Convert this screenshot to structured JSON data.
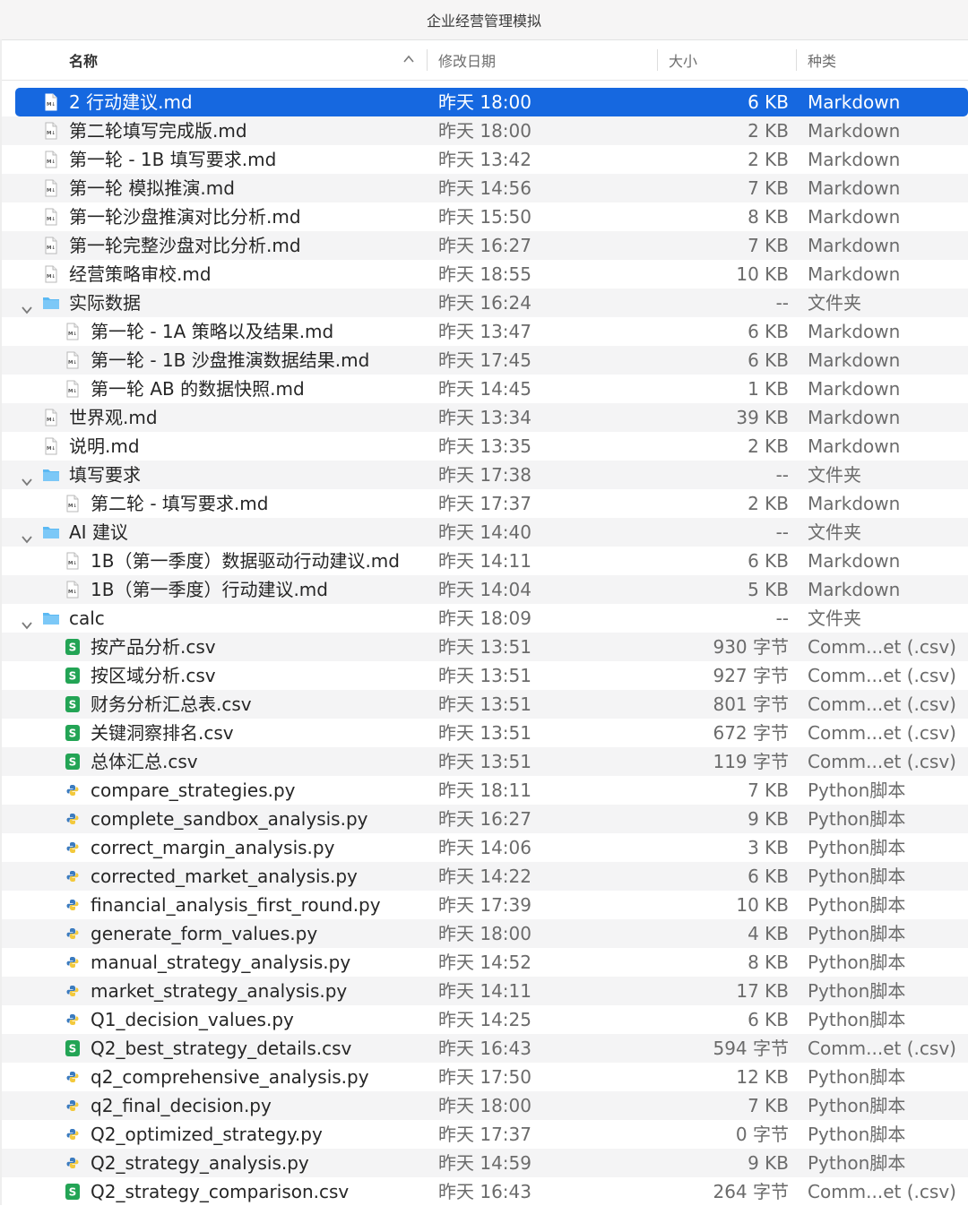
{
  "window": {
    "title": "企业经营管理模拟"
  },
  "columns": {
    "name": "名称",
    "date": "修改日期",
    "size": "大小",
    "kind": "种类"
  },
  "rows": [
    {
      "name": "2 行动建议.md",
      "date": "昨天 18:00",
      "size": "6 KB",
      "kind": "Markdown",
      "icon": "md",
      "level": 0,
      "selected": true
    },
    {
      "name": "第二轮填写完成版.md",
      "date": "昨天 18:00",
      "size": "2 KB",
      "kind": "Markdown",
      "icon": "md",
      "level": 0
    },
    {
      "name": "第一轮 - 1B 填写要求.md",
      "date": "昨天 13:42",
      "size": "2 KB",
      "kind": "Markdown",
      "icon": "md",
      "level": 0
    },
    {
      "name": "第一轮 模拟推演.md",
      "date": "昨天 14:56",
      "size": "7 KB",
      "kind": "Markdown",
      "icon": "md",
      "level": 0
    },
    {
      "name": "第一轮沙盘推演对比分析.md",
      "date": "昨天 15:50",
      "size": "8 KB",
      "kind": "Markdown",
      "icon": "md",
      "level": 0
    },
    {
      "name": "第一轮完整沙盘对比分析.md",
      "date": "昨天 16:27",
      "size": "7 KB",
      "kind": "Markdown",
      "icon": "md",
      "level": 0
    },
    {
      "name": "经营策略审校.md",
      "date": "昨天 18:55",
      "size": "10 KB",
      "kind": "Markdown",
      "icon": "md",
      "level": 0
    },
    {
      "name": "实际数据",
      "date": "昨天 16:24",
      "size": "--",
      "kind": "文件夹",
      "icon": "folder",
      "level": 0
    },
    {
      "name": "第一轮 - 1A 策略以及结果.md",
      "date": "昨天 13:47",
      "size": "6 KB",
      "kind": "Markdown",
      "icon": "md",
      "level": 1
    },
    {
      "name": "第一轮 - 1B 沙盘推演数据结果.md",
      "date": "昨天 17:45",
      "size": "6 KB",
      "kind": "Markdown",
      "icon": "md",
      "level": 1
    },
    {
      "name": "第一轮 AB 的数据快照.md",
      "date": "昨天 14:45",
      "size": "1 KB",
      "kind": "Markdown",
      "icon": "md",
      "level": 1
    },
    {
      "name": "世界观.md",
      "date": "昨天 13:34",
      "size": "39 KB",
      "kind": "Markdown",
      "icon": "md",
      "level": 0
    },
    {
      "name": "说明.md",
      "date": "昨天 13:35",
      "size": "2 KB",
      "kind": "Markdown",
      "icon": "md",
      "level": 0
    },
    {
      "name": "填写要求",
      "date": "昨天 17:38",
      "size": "--",
      "kind": "文件夹",
      "icon": "folder",
      "level": 0
    },
    {
      "name": "第二轮 - 填写要求.md",
      "date": "昨天 17:37",
      "size": "2 KB",
      "kind": "Markdown",
      "icon": "md",
      "level": 1
    },
    {
      "name": "AI 建议",
      "date": "昨天 14:40",
      "size": "--",
      "kind": "文件夹",
      "icon": "folder",
      "level": 0
    },
    {
      "name": "1B（第一季度）数据驱动行动建议.md",
      "date": "昨天 14:11",
      "size": "6 KB",
      "kind": "Markdown",
      "icon": "md",
      "level": 1
    },
    {
      "name": "1B（第一季度）行动建议.md",
      "date": "昨天 14:04",
      "size": "5 KB",
      "kind": "Markdown",
      "icon": "md",
      "level": 1
    },
    {
      "name": "calc",
      "date": "昨天 18:09",
      "size": "--",
      "kind": "文件夹",
      "icon": "folder",
      "level": 0
    },
    {
      "name": "按产品分析.csv",
      "date": "昨天 13:51",
      "size": "930 字节",
      "kind": "Comm...et (.csv)",
      "icon": "csv",
      "level": 1
    },
    {
      "name": "按区域分析.csv",
      "date": "昨天 13:51",
      "size": "927 字节",
      "kind": "Comm...et (.csv)",
      "icon": "csv",
      "level": 1
    },
    {
      "name": "财务分析汇总表.csv",
      "date": "昨天 13:51",
      "size": "801 字节",
      "kind": "Comm...et (.csv)",
      "icon": "csv",
      "level": 1
    },
    {
      "name": "关键洞察排名.csv",
      "date": "昨天 13:51",
      "size": "672 字节",
      "kind": "Comm...et (.csv)",
      "icon": "csv",
      "level": 1
    },
    {
      "name": "总体汇总.csv",
      "date": "昨天 13:51",
      "size": "119 字节",
      "kind": "Comm...et (.csv)",
      "icon": "csv",
      "level": 1
    },
    {
      "name": "compare_strategies.py",
      "date": "昨天 18:11",
      "size": "7 KB",
      "kind": "Python脚本",
      "icon": "py",
      "level": 1
    },
    {
      "name": "complete_sandbox_analysis.py",
      "date": "昨天 16:27",
      "size": "9 KB",
      "kind": "Python脚本",
      "icon": "py",
      "level": 1
    },
    {
      "name": "correct_margin_analysis.py",
      "date": "昨天 14:06",
      "size": "3 KB",
      "kind": "Python脚本",
      "icon": "py",
      "level": 1
    },
    {
      "name": "corrected_market_analysis.py",
      "date": "昨天 14:22",
      "size": "6 KB",
      "kind": "Python脚本",
      "icon": "py",
      "level": 1
    },
    {
      "name": "financial_analysis_first_round.py",
      "date": "昨天 17:39",
      "size": "10 KB",
      "kind": "Python脚本",
      "icon": "py",
      "level": 1
    },
    {
      "name": "generate_form_values.py",
      "date": "昨天 18:00",
      "size": "4 KB",
      "kind": "Python脚本",
      "icon": "py",
      "level": 1
    },
    {
      "name": "manual_strategy_analysis.py",
      "date": "昨天 14:52",
      "size": "8 KB",
      "kind": "Python脚本",
      "icon": "py",
      "level": 1
    },
    {
      "name": "market_strategy_analysis.py",
      "date": "昨天 14:11",
      "size": "17 KB",
      "kind": "Python脚本",
      "icon": "py",
      "level": 1
    },
    {
      "name": "Q1_decision_values.py",
      "date": "昨天 14:25",
      "size": "6 KB",
      "kind": "Python脚本",
      "icon": "py",
      "level": 1
    },
    {
      "name": "Q2_best_strategy_details.csv",
      "date": "昨天 16:43",
      "size": "594 字节",
      "kind": "Comm...et (.csv)",
      "icon": "csv",
      "level": 1
    },
    {
      "name": "q2_comprehensive_analysis.py",
      "date": "昨天 17:50",
      "size": "12 KB",
      "kind": "Python脚本",
      "icon": "py",
      "level": 1
    },
    {
      "name": "q2_final_decision.py",
      "date": "昨天 18:00",
      "size": "7 KB",
      "kind": "Python脚本",
      "icon": "py",
      "level": 1
    },
    {
      "name": "Q2_optimized_strategy.py",
      "date": "昨天 17:37",
      "size": "0 字节",
      "kind": "Python脚本",
      "icon": "py",
      "level": 1
    },
    {
      "name": "Q2_strategy_analysis.py",
      "date": "昨天 14:59",
      "size": "9 KB",
      "kind": "Python脚本",
      "icon": "py",
      "level": 1
    },
    {
      "name": "Q2_strategy_comparison.csv",
      "date": "昨天 16:43",
      "size": "264 字节",
      "kind": "Comm...et (.csv)",
      "icon": "csv",
      "level": 1
    }
  ],
  "colors": {
    "selection": "#1668e0",
    "folder": "#4fb3f0",
    "csv": "#23a455",
    "python": "#3b7bbf"
  }
}
